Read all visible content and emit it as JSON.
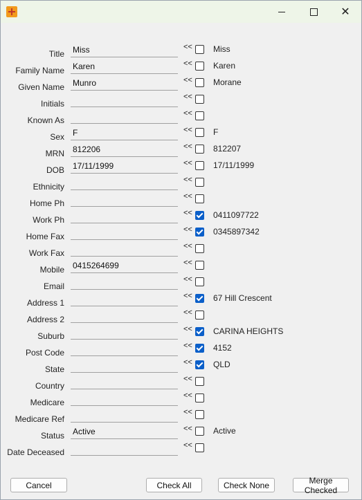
{
  "window": {
    "title": "",
    "controls": {
      "minimize": "—",
      "maximize": "",
      "close": "✕"
    }
  },
  "arrow_text": "<<",
  "rows": [
    {
      "label": "Title",
      "value": "Miss",
      "checked": false,
      "source": "Miss"
    },
    {
      "label": "Family Name",
      "value": "Karen",
      "checked": false,
      "source": "Karen"
    },
    {
      "label": "Given Name",
      "value": "Munro",
      "checked": false,
      "source": "Morane"
    },
    {
      "label": "Initials",
      "value": "",
      "checked": false,
      "source": ""
    },
    {
      "label": "Known As",
      "value": "",
      "checked": false,
      "source": ""
    },
    {
      "label": "Sex",
      "value": "F",
      "checked": false,
      "source": "F"
    },
    {
      "label": "MRN",
      "value": "812206",
      "checked": false,
      "source": "812207"
    },
    {
      "label": "DOB",
      "value": "17/11/1999",
      "checked": false,
      "source": "17/11/1999"
    },
    {
      "label": "Ethnicity",
      "value": "",
      "checked": false,
      "source": ""
    },
    {
      "label": "Home Ph",
      "value": "",
      "checked": false,
      "source": ""
    },
    {
      "label": "Work Ph",
      "value": "",
      "checked": true,
      "source": "0411097722"
    },
    {
      "label": "Home Fax",
      "value": "",
      "checked": true,
      "source": "0345897342"
    },
    {
      "label": "Work Fax",
      "value": "",
      "checked": false,
      "source": ""
    },
    {
      "label": "Mobile",
      "value": "0415264699",
      "checked": false,
      "source": ""
    },
    {
      "label": "Email",
      "value": "",
      "checked": false,
      "source": ""
    },
    {
      "label": "Address 1",
      "value": "",
      "checked": true,
      "source": "67 Hill Crescent"
    },
    {
      "label": "Address 2",
      "value": "",
      "checked": false,
      "source": ""
    },
    {
      "label": "Suburb",
      "value": "",
      "checked": true,
      "source": "CARINA HEIGHTS"
    },
    {
      "label": "Post Code",
      "value": "",
      "checked": true,
      "source": "4152"
    },
    {
      "label": "State",
      "value": "",
      "checked": true,
      "source": "QLD"
    },
    {
      "label": "Country",
      "value": "",
      "checked": false,
      "source": ""
    },
    {
      "label": "Medicare",
      "value": "",
      "checked": false,
      "source": ""
    },
    {
      "label": "Medicare Ref",
      "value": "",
      "checked": false,
      "source": ""
    },
    {
      "label": "Status",
      "value": "Active",
      "checked": false,
      "source": "Active"
    },
    {
      "label": "Date Deceased",
      "value": "",
      "checked": false,
      "source": ""
    }
  ],
  "buttons": {
    "cancel": "Cancel",
    "check_all": "Check All",
    "check_none": "Check None",
    "merge_checked": "Merge Checked"
  },
  "colors": {
    "titlebar_bg": "#eef5e8",
    "checkbox_checked": "#0b5fc9",
    "app_icon": "#f29a1c"
  }
}
